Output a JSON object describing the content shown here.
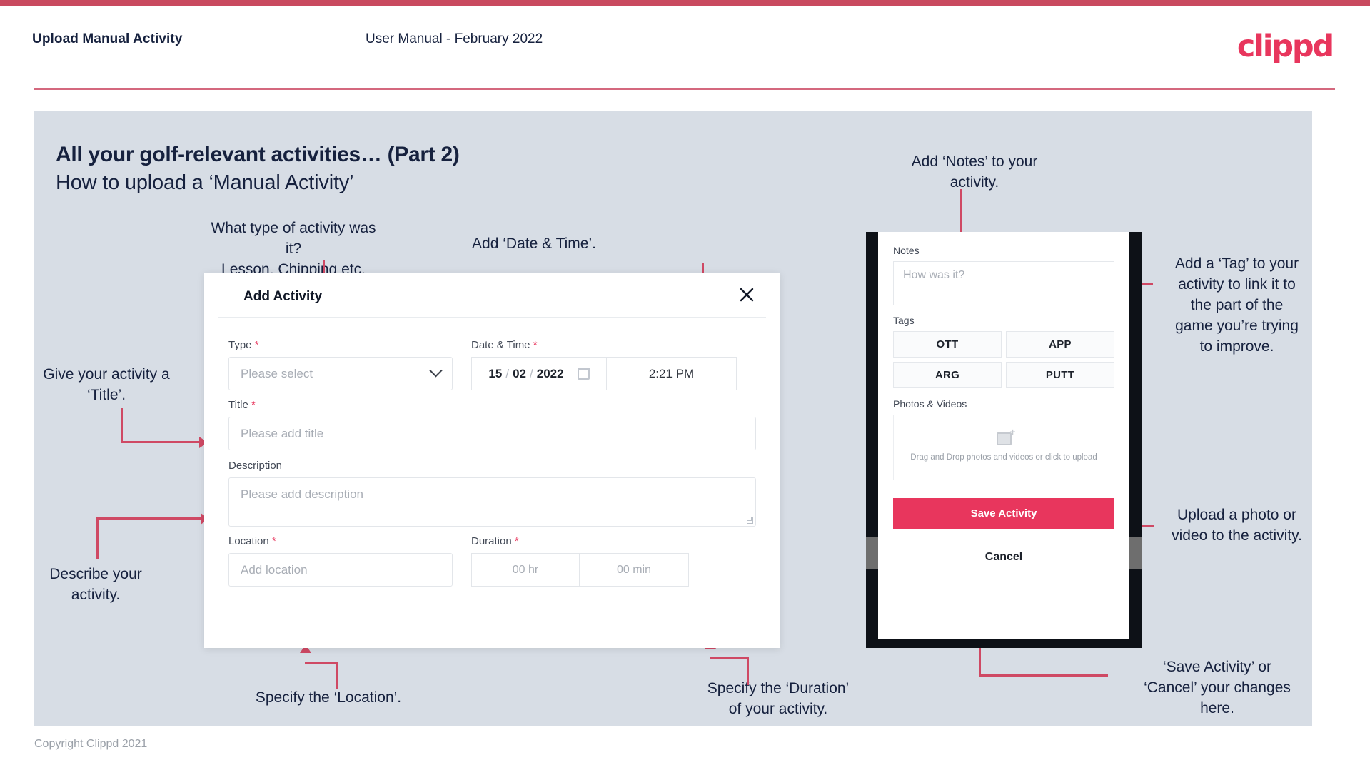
{
  "header": {
    "title": "Upload Manual Activity",
    "subtitle": "User Manual - February 2022",
    "logo": "clippd"
  },
  "slide": {
    "title": "All your golf-relevant activities… (Part 2)",
    "subtitle": "How to upload a ‘Manual Activity’"
  },
  "annotations": {
    "type": "What type of activity was it?\nLesson, Chipping etc.",
    "datetime": "Add ‘Date & Time’.",
    "title_field": "Give your activity a\n‘Title’.",
    "description": "Describe your\nactivity.",
    "location": "Specify the ‘Location’.",
    "duration": "Specify the ‘Duration’\nof your activity.",
    "notes": "Add ‘Notes’ to your\nactivity.",
    "tags": "Add a ‘Tag’ to your\nactivity to link it to\nthe part of the\ngame you’re trying\nto improve.",
    "upload": "Upload a photo or\nvideo to the activity.",
    "save": "‘Save Activity’ or\n‘Cancel’ your changes\nhere."
  },
  "dialog": {
    "title": "Add Activity",
    "close_icon": "✕",
    "fields": {
      "type": {
        "label": "Type",
        "required": "*",
        "value": "Please select"
      },
      "datetime": {
        "label": "Date & Time",
        "required": "*",
        "day": "15",
        "month": "02",
        "year": "2022",
        "sep": "/",
        "time": "2:21 PM"
      },
      "title": {
        "label": "Title",
        "required": "*",
        "placeholder": "Please add title"
      },
      "description": {
        "label": "Description",
        "placeholder": "Please add description"
      },
      "location": {
        "label": "Location",
        "required": "*",
        "placeholder": "Add location"
      },
      "duration": {
        "label": "Duration",
        "required": "*",
        "hours": "00 hr",
        "minutes": "00 min"
      }
    }
  },
  "phone": {
    "notes_label": "Notes",
    "notes_placeholder": "How was it?",
    "tags_label": "Tags",
    "tags": [
      "OTT",
      "APP",
      "ARG",
      "PUTT"
    ],
    "photos_label": "Photos & Videos",
    "drop_text": "Drag and Drop photos and videos or click to upload",
    "save_label": "Save Activity",
    "cancel_label": "Cancel"
  },
  "footer": {
    "copyright": "Copyright Clippd 2021"
  },
  "colors": {
    "accent": "#e8365d",
    "line": "#cf4964",
    "slide_bg": "#d7dde5",
    "dark": "#16213e"
  }
}
